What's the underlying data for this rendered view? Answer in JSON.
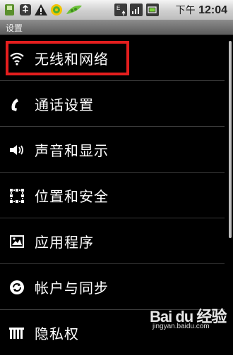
{
  "status_bar": {
    "time_prefix": "下午",
    "time": "12:04",
    "icons": [
      "sd-card-icon",
      "usb-debug-icon",
      "warning-icon",
      "smiley-icon",
      "pea-app-icon",
      "data-arrows-icon",
      "signal-bars-icon",
      "battery-icon"
    ]
  },
  "title_bar": {
    "title": "设置"
  },
  "settings": {
    "items": [
      {
        "label": "无线和网络",
        "icon": "wireless-icon"
      },
      {
        "label": "通话设置",
        "icon": "phone-icon"
      },
      {
        "label": "声音和显示",
        "icon": "speaker-icon"
      },
      {
        "label": "位置和安全",
        "icon": "location-grid-icon"
      },
      {
        "label": "应用程序",
        "icon": "applications-icon"
      },
      {
        "label": "帐户与同步",
        "icon": "sync-icon"
      },
      {
        "label": "隐私权",
        "icon": "privacy-icon"
      }
    ],
    "highlighted_index": 0
  },
  "watermark": {
    "logo": "Bai du 经验",
    "url": "jingyan.baidu.com"
  },
  "colors": {
    "highlight": "#e41e1e",
    "background": "#000000",
    "status_bar": "#d6d6d6",
    "title_bar": "#6e6e6e"
  }
}
